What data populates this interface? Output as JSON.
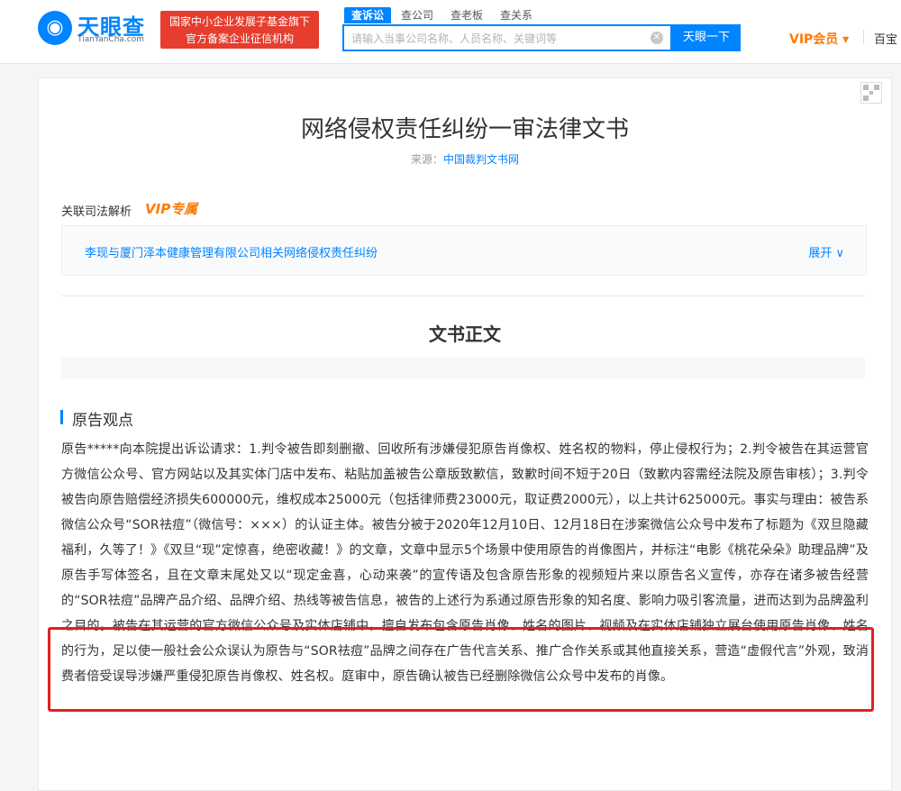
{
  "header": {
    "logo": {
      "name": "天眼查",
      "subtitle": "TianYanCha.com"
    },
    "badge": {
      "line1": "国家中小企业发展子基金旗下",
      "line2": "官方备案企业征信机构"
    },
    "search_tabs": [
      "查诉讼",
      "查公司",
      "查老板",
      "查关系"
    ],
    "search": {
      "placeholder": "请输入当事公司名称、人员名称、关键词等",
      "button": "天眼一下"
    },
    "vip_label": "VIP会员 ▾",
    "baike_label": "百宝"
  },
  "document": {
    "title": "网络侵权责任纠纷一审法律文书",
    "source_label": "来源：",
    "source_link": "中国裁判文书网",
    "related_label": "关联司法解析",
    "related_vip": "VIP专属",
    "related_case": "李现与厦门泽本健康管理有限公司相关网络侵权责任纠纷",
    "expand_label": "展开 ∨",
    "section_title": "文书正文",
    "opinion_title": "原告观点",
    "body": "原告*****向本院提出诉讼请求：1.判令被告即刻删撤、回收所有涉嫌侵犯原告肖像权、姓名权的物料，停止侵权行为；2.判令被告在其运营官方微信公众号、官方网站以及其实体门店中发布、粘贴加盖被告公章版致歉信，致歉时间不短于20日（致歉内容需经法院及原告审核）；3.判令被告向原告赔偿经济损失600000元，维权成本25000元（包括律师费23000元，取证费2000元），以上共计625000元。事实与理由：被告系微信公众号“SOR祛痘”（微信号：×××）的认证主体。被告分被于2020年12月10日、12月18日在涉案微信公众号中发布了标题为《双旦隐藏福利，久等了！》《双旦“现”定惊喜，绝密收藏！》的文章，文章中显示5个场景中使用原告的肖像图片，并标注“电影《桃花朵朵》助理品牌”及原告手写体签名，且在文章末尾处又以“现定金喜，心动来袭”的宣传语及包含原告形象的视频短片来以原告名义宣传，亦存在诸多被告经营的“SOR祛痘”品牌产品介绍、品牌介绍、热线等被告信息，被告的上述行为系通过原告形象的知名度、影响力吸引客流量，进而达到为品牌盈利之目的。被告在其运营的官方微信公众号及实体店铺中，擅自发布包含原告肖像、姓名的图片、视频及在实体店铺独立展台使用原告肖像、姓名的行为，足以使一般社会公众误认为原告与“SOR祛痘”品牌之间存在广告代言关系、推广合作关系或其他直接关系，营造“虚假代言”外观，致消费者倍受误导涉嫌严重侵犯原告肖像权、姓名权。庭审中，原告确认被告已经删除微信公众号中发布的肖像。"
  },
  "colors": {
    "brand": "#0084ff",
    "vip": "#ff7a00",
    "badge": "#e63d2e",
    "highlight": "#e02020"
  }
}
